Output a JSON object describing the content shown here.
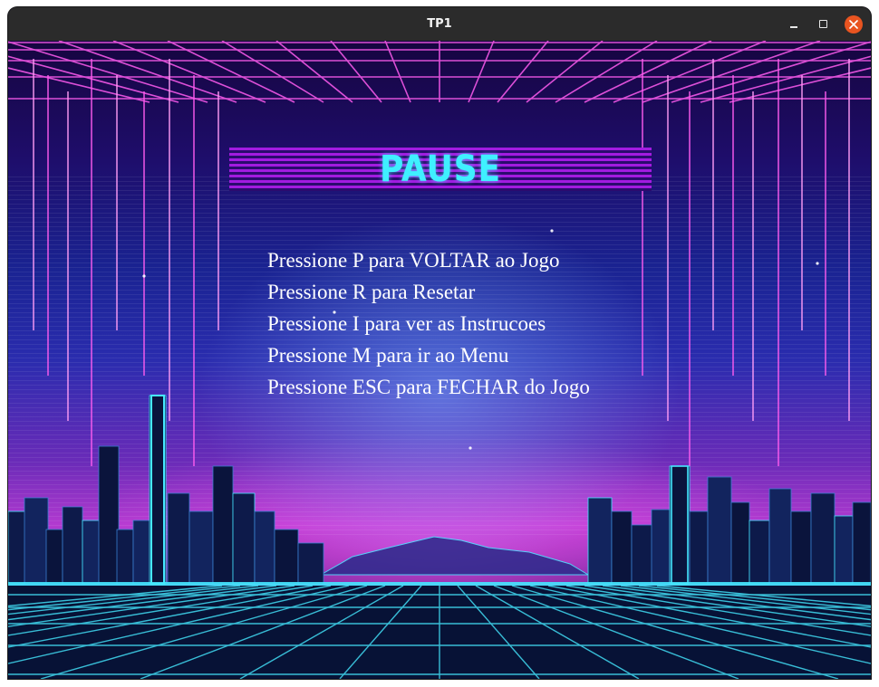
{
  "window": {
    "title": "TP1",
    "controls": [
      "minimize-icon",
      "maximize-icon",
      "close-icon"
    ],
    "close_color": "#e95420"
  },
  "game": {
    "pause_title": "PAUSE",
    "instructions": [
      "Pressione P para VOLTAR ao Jogo",
      "Pressione R para Resetar",
      "Pressione I para ver as Instrucoes",
      "Pressione M para ir ao Menu",
      "Pressione ESC para FECHAR do Jogo"
    ],
    "colors": {
      "title_text": "#3ff0ff",
      "banner_stripe": "#a21be0",
      "neon_cyan": "#45e8ff",
      "neon_pink": "#ff5cf0"
    }
  }
}
